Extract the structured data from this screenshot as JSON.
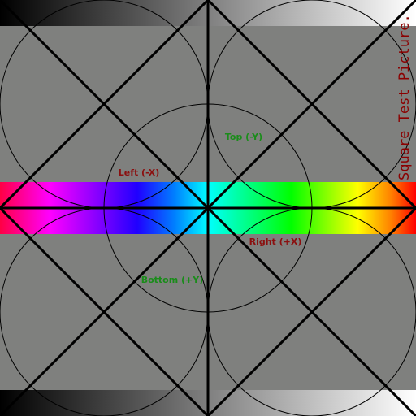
{
  "title": "Square Test Picture.",
  "labels": {
    "top": "Top (-Y)",
    "left": "Left (-X)",
    "right": "Right (+X)",
    "bottom": "Bottom (+Y)"
  },
  "colors": {
    "background": "#7f807e",
    "lines": "#000000",
    "title": "#8b0000",
    "left_right_labels": "#8b0f0f",
    "top_bottom_labels": "#1a8c1a"
  },
  "gradients": {
    "grayscale_top": "black-to-white",
    "grayscale_bottom": "black-to-white",
    "spectrum": [
      "#ff0044",
      "#ff00ff",
      "#8000ff",
      "#2000ff",
      "#0080ff",
      "#00ffff",
      "#00ff80",
      "#00ff00",
      "#80ff00",
      "#ffff00",
      "#ff8000",
      "#ff0000"
    ]
  }
}
